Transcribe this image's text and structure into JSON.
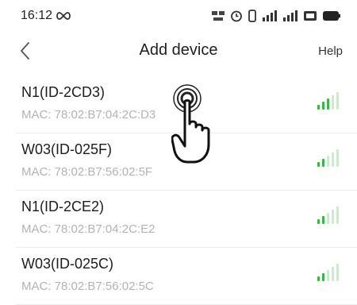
{
  "status_bar": {
    "time": "16:12",
    "icons": [
      "infinity-icon",
      "data-speed-icon",
      "alarm-icon",
      "vibrate-icon",
      "signal-1-icon",
      "signal-2-icon",
      "hd-icon",
      "battery-icon"
    ]
  },
  "nav": {
    "title": "Add device",
    "help_label": "Help"
  },
  "devices": [
    {
      "name": "N1(ID-2CD3)",
      "mac": "MAC: 78:02:B7:04:2C:D3"
    },
    {
      "name": "W03(ID-025F)",
      "mac": "MAC: 78:02:B7:56:02:5F"
    },
    {
      "name": "N1(ID-2CE2)",
      "mac": "MAC: 78:02:B7:04:2C:E2"
    },
    {
      "name": "W03(ID-025C)",
      "mac": "MAC: 78:02:B7:56:02:5C"
    }
  ],
  "colors": {
    "signal_active": "#3cb44a",
    "signal_inactive": "#cfe9cf",
    "text_primary": "#1d1d1d",
    "text_secondary": "#b3b3b3"
  }
}
